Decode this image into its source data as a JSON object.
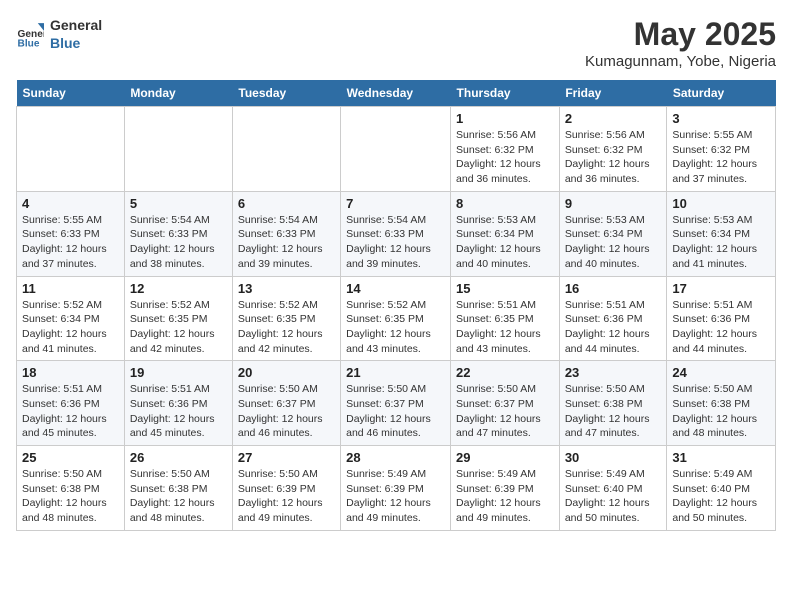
{
  "header": {
    "logo_general": "General",
    "logo_blue": "Blue",
    "title": "May 2025",
    "subtitle": "Kumagunnam, Yobe, Nigeria"
  },
  "days_of_week": [
    "Sunday",
    "Monday",
    "Tuesday",
    "Wednesday",
    "Thursday",
    "Friday",
    "Saturday"
  ],
  "weeks": [
    [
      {
        "day": "",
        "info": ""
      },
      {
        "day": "",
        "info": ""
      },
      {
        "day": "",
        "info": ""
      },
      {
        "day": "",
        "info": ""
      },
      {
        "day": "1",
        "info": "Sunrise: 5:56 AM\nSunset: 6:32 PM\nDaylight: 12 hours\nand 36 minutes."
      },
      {
        "day": "2",
        "info": "Sunrise: 5:56 AM\nSunset: 6:32 PM\nDaylight: 12 hours\nand 36 minutes."
      },
      {
        "day": "3",
        "info": "Sunrise: 5:55 AM\nSunset: 6:32 PM\nDaylight: 12 hours\nand 37 minutes."
      }
    ],
    [
      {
        "day": "4",
        "info": "Sunrise: 5:55 AM\nSunset: 6:33 PM\nDaylight: 12 hours\nand 37 minutes."
      },
      {
        "day": "5",
        "info": "Sunrise: 5:54 AM\nSunset: 6:33 PM\nDaylight: 12 hours\nand 38 minutes."
      },
      {
        "day": "6",
        "info": "Sunrise: 5:54 AM\nSunset: 6:33 PM\nDaylight: 12 hours\nand 39 minutes."
      },
      {
        "day": "7",
        "info": "Sunrise: 5:54 AM\nSunset: 6:33 PM\nDaylight: 12 hours\nand 39 minutes."
      },
      {
        "day": "8",
        "info": "Sunrise: 5:53 AM\nSunset: 6:34 PM\nDaylight: 12 hours\nand 40 minutes."
      },
      {
        "day": "9",
        "info": "Sunrise: 5:53 AM\nSunset: 6:34 PM\nDaylight: 12 hours\nand 40 minutes."
      },
      {
        "day": "10",
        "info": "Sunrise: 5:53 AM\nSunset: 6:34 PM\nDaylight: 12 hours\nand 41 minutes."
      }
    ],
    [
      {
        "day": "11",
        "info": "Sunrise: 5:52 AM\nSunset: 6:34 PM\nDaylight: 12 hours\nand 41 minutes."
      },
      {
        "day": "12",
        "info": "Sunrise: 5:52 AM\nSunset: 6:35 PM\nDaylight: 12 hours\nand 42 minutes."
      },
      {
        "day": "13",
        "info": "Sunrise: 5:52 AM\nSunset: 6:35 PM\nDaylight: 12 hours\nand 42 minutes."
      },
      {
        "day": "14",
        "info": "Sunrise: 5:52 AM\nSunset: 6:35 PM\nDaylight: 12 hours\nand 43 minutes."
      },
      {
        "day": "15",
        "info": "Sunrise: 5:51 AM\nSunset: 6:35 PM\nDaylight: 12 hours\nand 43 minutes."
      },
      {
        "day": "16",
        "info": "Sunrise: 5:51 AM\nSunset: 6:36 PM\nDaylight: 12 hours\nand 44 minutes."
      },
      {
        "day": "17",
        "info": "Sunrise: 5:51 AM\nSunset: 6:36 PM\nDaylight: 12 hours\nand 44 minutes."
      }
    ],
    [
      {
        "day": "18",
        "info": "Sunrise: 5:51 AM\nSunset: 6:36 PM\nDaylight: 12 hours\nand 45 minutes."
      },
      {
        "day": "19",
        "info": "Sunrise: 5:51 AM\nSunset: 6:36 PM\nDaylight: 12 hours\nand 45 minutes."
      },
      {
        "day": "20",
        "info": "Sunrise: 5:50 AM\nSunset: 6:37 PM\nDaylight: 12 hours\nand 46 minutes."
      },
      {
        "day": "21",
        "info": "Sunrise: 5:50 AM\nSunset: 6:37 PM\nDaylight: 12 hours\nand 46 minutes."
      },
      {
        "day": "22",
        "info": "Sunrise: 5:50 AM\nSunset: 6:37 PM\nDaylight: 12 hours\nand 47 minutes."
      },
      {
        "day": "23",
        "info": "Sunrise: 5:50 AM\nSunset: 6:38 PM\nDaylight: 12 hours\nand 47 minutes."
      },
      {
        "day": "24",
        "info": "Sunrise: 5:50 AM\nSunset: 6:38 PM\nDaylight: 12 hours\nand 48 minutes."
      }
    ],
    [
      {
        "day": "25",
        "info": "Sunrise: 5:50 AM\nSunset: 6:38 PM\nDaylight: 12 hours\nand 48 minutes."
      },
      {
        "day": "26",
        "info": "Sunrise: 5:50 AM\nSunset: 6:38 PM\nDaylight: 12 hours\nand 48 minutes."
      },
      {
        "day": "27",
        "info": "Sunrise: 5:50 AM\nSunset: 6:39 PM\nDaylight: 12 hours\nand 49 minutes."
      },
      {
        "day": "28",
        "info": "Sunrise: 5:49 AM\nSunset: 6:39 PM\nDaylight: 12 hours\nand 49 minutes."
      },
      {
        "day": "29",
        "info": "Sunrise: 5:49 AM\nSunset: 6:39 PM\nDaylight: 12 hours\nand 49 minutes."
      },
      {
        "day": "30",
        "info": "Sunrise: 5:49 AM\nSunset: 6:40 PM\nDaylight: 12 hours\nand 50 minutes."
      },
      {
        "day": "31",
        "info": "Sunrise: 5:49 AM\nSunset: 6:40 PM\nDaylight: 12 hours\nand 50 minutes."
      }
    ]
  ]
}
